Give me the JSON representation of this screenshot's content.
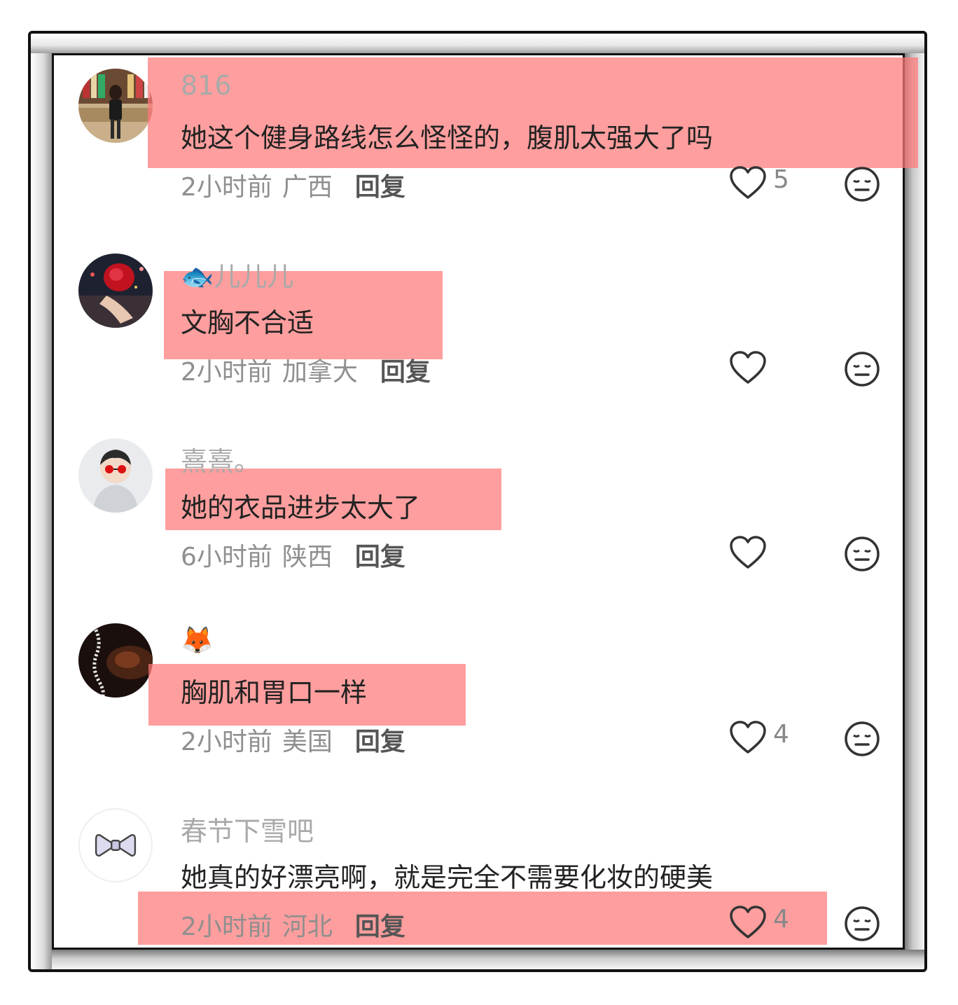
{
  "comments": [
    {
      "username": "816",
      "text": "她这个健身路线怎么怪怪的，腹肌太强大了吗",
      "time": "2小时前",
      "location": "广西",
      "reply_label": "回复",
      "likes": "5",
      "avatar_icon": "avatar-photo-bookstore"
    },
    {
      "username_emoji": "🐟",
      "username": "儿儿儿",
      "text": "文胸不合适",
      "time": "2小时前",
      "location": "加拿大",
      "reply_label": "回复",
      "likes": "",
      "avatar_icon": "avatar-photo-red-rose"
    },
    {
      "username": "熹熹。",
      "text": "她的衣品进步太大了",
      "time": "6小时前",
      "location": "陕西",
      "reply_label": "回复",
      "likes": "",
      "avatar_icon": "avatar-photo-child-sunglasses"
    },
    {
      "username_emoji": "🦊",
      "text": "胸肌和胃口一样",
      "time": "2小时前",
      "location": "美国",
      "reply_label": "回复",
      "likes": "4",
      "avatar_icon": "avatar-photo-dark-spiral"
    },
    {
      "username": "春节下雪吧",
      "text": "她真的好漂亮啊，就是完全不需要化妆的硬美",
      "time": "2小时前",
      "location": "河北",
      "reply_label": "回复",
      "likes": "4",
      "avatar_icon": "avatar-bow"
    }
  ],
  "colors": {
    "highlight": "#ff7878",
    "frame": "#111111"
  }
}
